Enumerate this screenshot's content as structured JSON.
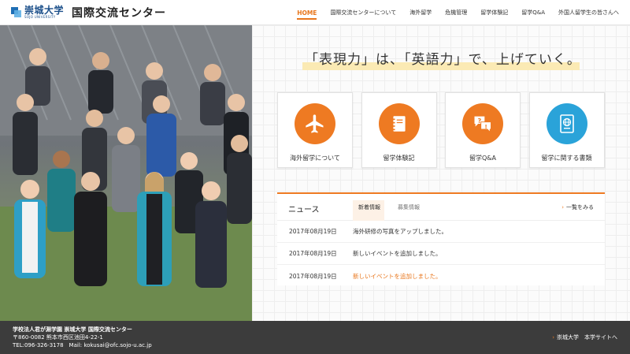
{
  "header": {
    "logo_text": "崇城大学",
    "logo_sub": "SOJO UNIVERSITY",
    "site_title": "国際交流センター"
  },
  "nav": [
    {
      "label": "HOME",
      "active": true
    },
    {
      "label": "国際交流センターについて"
    },
    {
      "label": "海外留学"
    },
    {
      "label": "危機管理"
    },
    {
      "label": "留学体験記"
    },
    {
      "label": "留学Q&A"
    },
    {
      "label": "外国人留学生の皆さんへ"
    }
  ],
  "hero": {
    "photo_alt": "group photo of smiling staff and students making fists"
  },
  "catchcopy": "「表現力」は、「英語力」で、上げていく。",
  "cards": [
    {
      "label": "海外留学について",
      "icon": "airplane-icon",
      "color": "#ee7a22"
    },
    {
      "label": "留学体験記",
      "icon": "notebook-icon",
      "color": "#ee7a22"
    },
    {
      "label": "留学Q&A",
      "icon": "speech-bubbles-icon",
      "color": "#ee7a22"
    },
    {
      "label": "留学に関する書類",
      "icon": "passport-icon",
      "color": "#2aa3d9"
    }
  ],
  "news": {
    "title": "ニュース",
    "tabs": [
      "新着情報",
      "募集情報"
    ],
    "more": "一覧をみる",
    "items": [
      {
        "date": "2017年08月19日",
        "text": "海外研修の写真をアップしました。"
      },
      {
        "date": "2017年08月19日",
        "text": "新しいイベントを追加しました。"
      },
      {
        "date": "2017年08月19日",
        "text": "新しいイベントを追加しました。"
      }
    ]
  },
  "footer": {
    "org": "学校法人君が淵学園 崇城大学 国際交流センター",
    "address": "〒860-0082 熊本市西区池田4-22-1",
    "contact": "TEL:096-326-3178　Mail: kokusai@ofc.sojo-u.ac.jp",
    "link": "崇城大学　本学サイトへ"
  },
  "colors": {
    "accent": "#ee7a22",
    "blue": "#2aa3d9",
    "footer_bg": "#3c3c3c"
  }
}
